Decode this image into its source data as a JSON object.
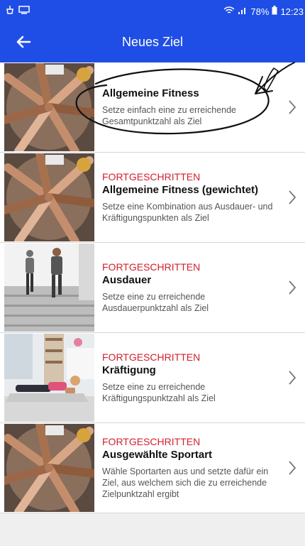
{
  "statusbar": {
    "battery": "78%",
    "time": "12:23"
  },
  "appbar": {
    "title": "Neues Ziel",
    "back_icon": "arrow-left-icon"
  },
  "items": [
    {
      "tag": "",
      "title": "Allgemeine Fitness",
      "description": "Setze einfach eine zu erreichende Gesamtpunktzahl als Ziel",
      "image": "hands-circle-photo"
    },
    {
      "tag": "FORTGESCHRITTEN",
      "title": "Allgemeine Fitness (gewichtet)",
      "description": "Setze eine Kombination aus Ausdauer- und Kräftigungspunkten als Ziel",
      "image": "hands-circle-photo"
    },
    {
      "tag": "FORTGESCHRITTEN",
      "title": "Ausdauer",
      "description": "Setze eine zu erreichende Ausdauerpunktzahl als Ziel",
      "image": "runners-stairs-photo"
    },
    {
      "tag": "FORTGESCHRITTEN",
      "title": "Kräftigung",
      "description": "Setze eine zu erreichende Kräftigungspunktzahl als Ziel",
      "image": "plank-photo"
    },
    {
      "tag": "FORTGESCHRITTEN",
      "title": "Ausgewählte Sportart",
      "description": "Wähle Sportarten aus und setzte dafür ein Ziel, aus welchem sich die zu erreichende Zielpunktzahl ergibt",
      "image": "hands-circle-photo"
    }
  ],
  "colors": {
    "appbar": "#1f4ee6",
    "tag": "#d21f2b",
    "background": "#efefef"
  }
}
